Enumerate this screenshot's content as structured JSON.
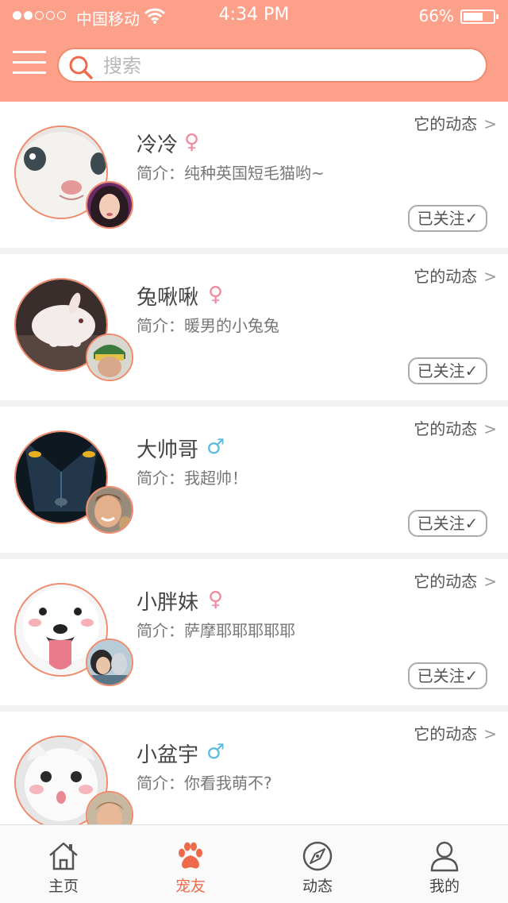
{
  "status_bar": {
    "carrier": "中国移动",
    "time": "4:34 PM",
    "battery": "66%",
    "battery_level": 0.66
  },
  "search": {
    "placeholder": "搜索"
  },
  "pets": [
    {
      "name": "冷冷",
      "gender": "female",
      "gender_symbol": "♀",
      "intro": "简介：纯种英国短毛猫哟~",
      "moments": "它的动态",
      "follow": "已关注✓"
    },
    {
      "name": "兔啾啾",
      "gender": "female",
      "gender_symbol": "♀",
      "intro": "简介：暖男的小兔兔",
      "moments": "它的动态",
      "follow": "已关注✓"
    },
    {
      "name": "大帅哥",
      "gender": "male",
      "gender_symbol": "♂",
      "intro": "简介：我超帅！",
      "moments": "它的动态",
      "follow": "已关注✓"
    },
    {
      "name": "小胖妹",
      "gender": "female",
      "gender_symbol": "♀",
      "intro": "简介：萨摩耶耶耶耶耶",
      "moments": "它的动态",
      "follow": "已关注✓"
    },
    {
      "name": "小盆宇",
      "gender": "male",
      "gender_symbol": "♂",
      "intro": "简介：你看我萌不?",
      "moments": "它的动态"
    }
  ],
  "tabs": [
    {
      "label": "主页",
      "icon": "home-icon"
    },
    {
      "label": "宠友",
      "icon": "paw-icon",
      "active": true
    },
    {
      "label": "动态",
      "icon": "compass-icon"
    },
    {
      "label": "我的",
      "icon": "user-icon"
    }
  ],
  "colors": {
    "header": "#fda08a",
    "accent": "#ee6a4a",
    "female": "#f08aa0",
    "male": "#5bbbe0"
  }
}
